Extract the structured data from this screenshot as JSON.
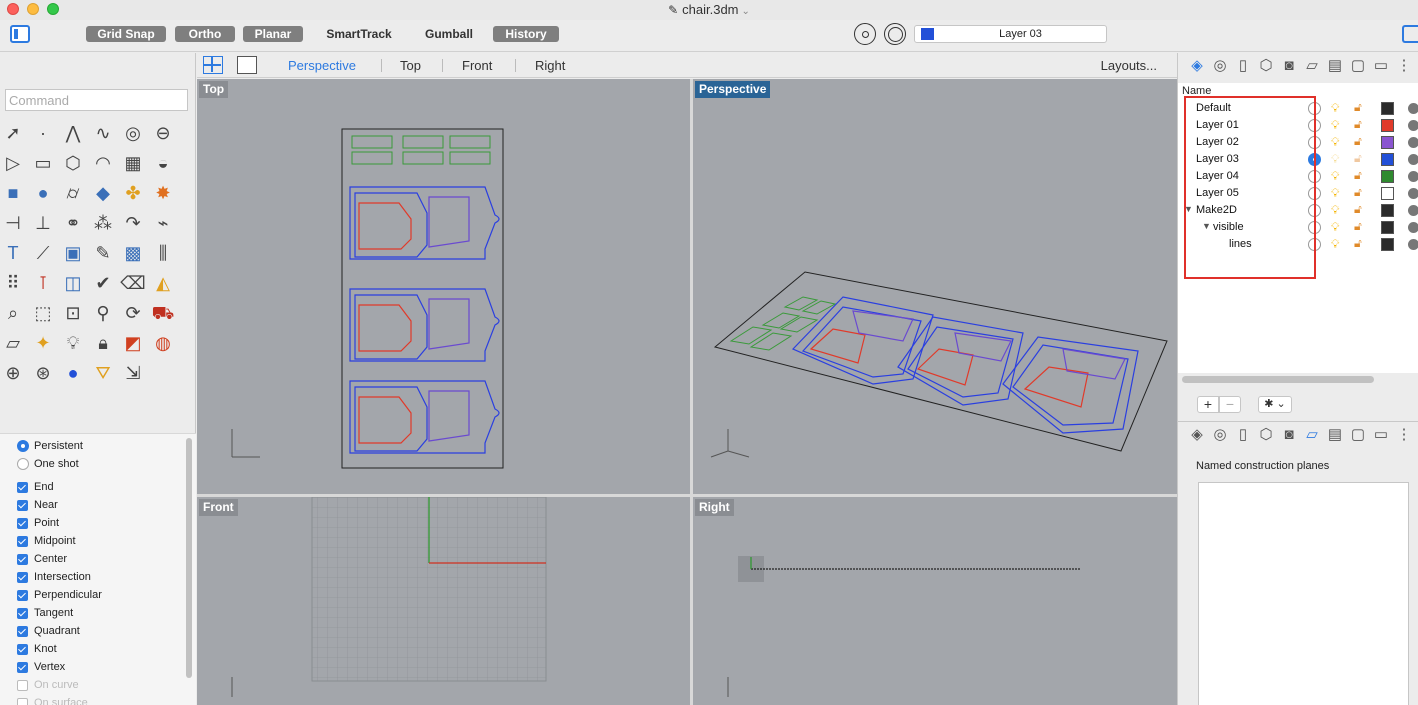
{
  "window": {
    "title": "chair.3dm"
  },
  "toolbar": {
    "buttons": [
      {
        "label": "Grid Snap",
        "active": true
      },
      {
        "label": "Ortho",
        "active": true
      },
      {
        "label": "Planar",
        "active": true
      },
      {
        "label": "SmartTrack",
        "active": false
      },
      {
        "label": "Gumball",
        "active": false
      },
      {
        "label": "History",
        "active": true
      }
    ],
    "current_layer": "Layer 03",
    "current_layer_color": "#2250d8"
  },
  "command": {
    "placeholder": "Command"
  },
  "viewport_tabs": {
    "tabs": [
      "Perspective",
      "Top",
      "Front",
      "Right"
    ],
    "active": "Perspective",
    "layouts_label": "Layouts..."
  },
  "viewports": {
    "top": "Top",
    "perspective": "Perspective",
    "front": "Front",
    "right": "Right"
  },
  "osnap": {
    "mode_persistent": "Persistent",
    "mode_one_shot": "One shot",
    "items": [
      {
        "label": "End",
        "checked": true
      },
      {
        "label": "Near",
        "checked": true
      },
      {
        "label": "Point",
        "checked": true
      },
      {
        "label": "Midpoint",
        "checked": true
      },
      {
        "label": "Center",
        "checked": true
      },
      {
        "label": "Intersection",
        "checked": true
      },
      {
        "label": "Perpendicular",
        "checked": true
      },
      {
        "label": "Tangent",
        "checked": true
      },
      {
        "label": "Quadrant",
        "checked": true
      },
      {
        "label": "Knot",
        "checked": true
      },
      {
        "label": "Vertex",
        "checked": true
      },
      {
        "label": "On curve",
        "checked": false
      },
      {
        "label": "On surface",
        "checked": false
      }
    ]
  },
  "layers": {
    "header": "Name",
    "rows": [
      {
        "name": "Default",
        "current": false,
        "color": "#2b2b2b",
        "level": 0
      },
      {
        "name": "Layer 01",
        "current": false,
        "color": "#e03a2a",
        "level": 0
      },
      {
        "name": "Layer 02",
        "current": false,
        "color": "#8a55d0",
        "level": 0
      },
      {
        "name": "Layer 03",
        "current": true,
        "color": "#2250d8",
        "level": 0
      },
      {
        "name": "Layer 04",
        "current": false,
        "color": "#2f8a2f",
        "level": 0
      },
      {
        "name": "Layer 05",
        "current": false,
        "color": "#ffffff",
        "level": 0
      },
      {
        "name": "Make2D",
        "current": false,
        "color": "#2b2b2b",
        "level": 0
      },
      {
        "name": "visible",
        "current": false,
        "color": "#2b2b2b",
        "level": 1
      },
      {
        "name": "lines",
        "current": false,
        "color": "#2b2b2b",
        "level": 2
      }
    ]
  },
  "cplanes": {
    "title": "Named construction planes"
  },
  "colors": {
    "accent": "#2d7ae0",
    "highlight": "#e0302a"
  }
}
